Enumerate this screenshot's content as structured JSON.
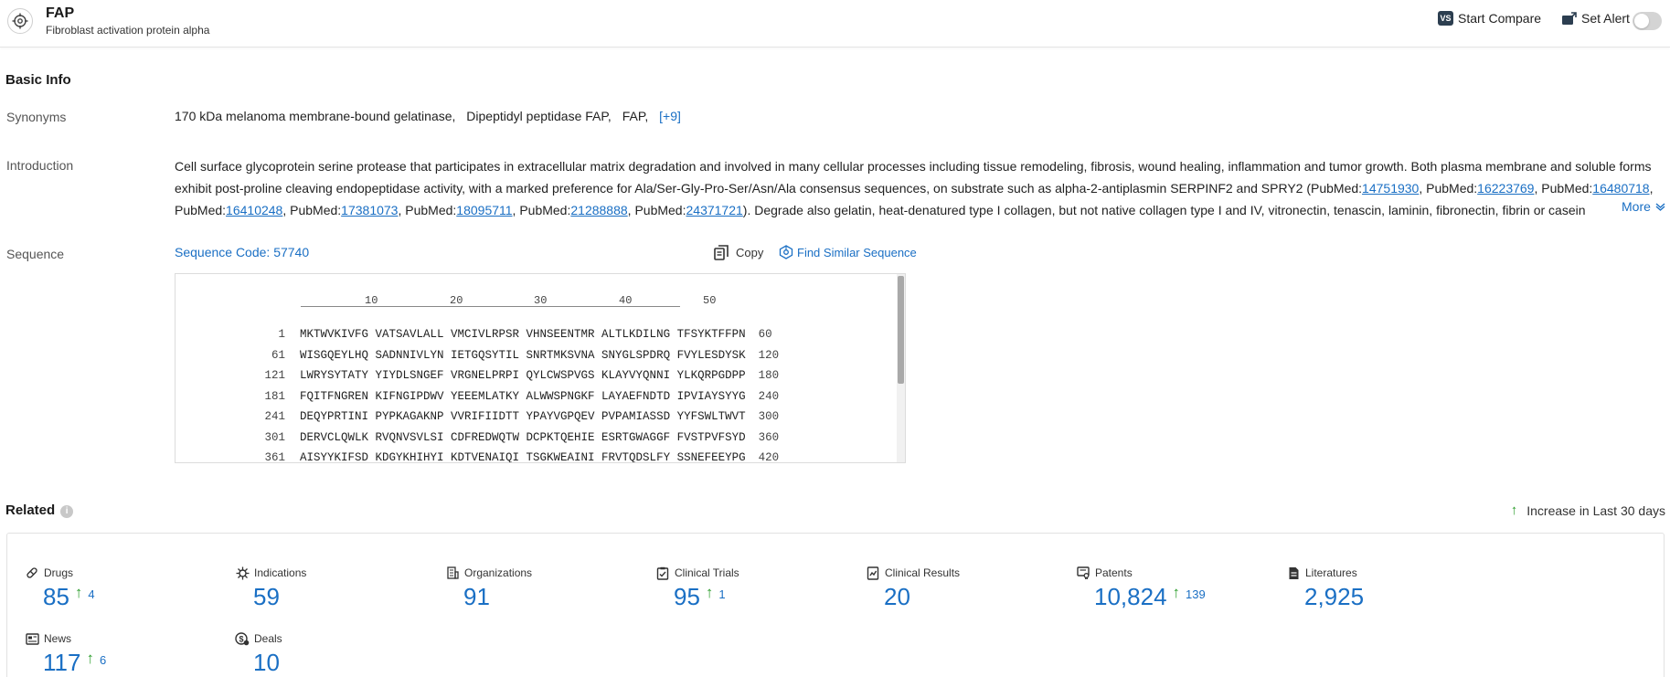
{
  "header": {
    "title": "FAP",
    "subtitle": "Fibroblast activation protein alpha",
    "compare_badge": "VS",
    "compare_label": "Start Compare",
    "alert_label": "Set Alert"
  },
  "basic_info": {
    "title": "Basic Info",
    "synonyms_label": "Synonyms",
    "synonyms": [
      "170 kDa melanoma membrane-bound gelatinase,",
      "Dipeptidyl peptidase FAP,",
      "FAP,"
    ],
    "synonyms_more": "[+9]",
    "introduction_label": "Introduction",
    "intro_text_1": "Cell surface glycoprotein serine protease that participates in extracellular matrix degradation and involved in many cellular processes including tissue remodeling, fibrosis, wound healing, inflammation and tumor growth. Both plasma membrane and soluble forms exhibit post-proline cleaving endopeptidase activity, with a marked preference for Ala/Ser-Gly-Pro-Ser/Asn/Ala consensus sequences, on substrate such as alpha-2-antiplasmin SERPINF2 and SPRY2 (PubMed:",
    "pubmed_prefix": "PubMed:",
    "pubmed_ids": [
      "14751930",
      "16223769",
      "16480718",
      "16410248",
      "17381073",
      "18095711",
      "21288888",
      "24371721"
    ],
    "intro_text_2": "). Degrade also gelatin, heat-denatured type I collagen, but not native collagen type I and IV, vitronectin, tenascin, laminin, fibronectin, fibrin or casein",
    "more_label": "More",
    "sequence_label": "Sequence",
    "sequence_code": "Sequence Code: 57740",
    "copy_label": "Copy",
    "find_similar_label": "Find Similar Sequence",
    "ruler": [
      "10",
      "20",
      "30",
      "40",
      "50"
    ],
    "sequence_lines": [
      {
        "start": "1",
        "residues": "MKTWVKIVFG VATSAVLALL VMCIVLRPSR VHNSEENTMR ALTLKDILNG TFSYKTFFPN",
        "end": "60"
      },
      {
        "start": "61",
        "residues": "WISGQEYLHQ SADNNIVLYN IETGQSYTIL SNRTMKSVNA SNYGLSPDRQ FVYLESDYSK",
        "end": "120"
      },
      {
        "start": "121",
        "residues": "LWRYSYTATY YIYDLSNGEF VRGNELPRPI QYLCWSPVGS KLAYVYQNNI YLKQRPGDPP",
        "end": "180"
      },
      {
        "start": "181",
        "residues": "FQITFNGREN KIFNGIPDWV YEEEMLATKY ALWWSPNGKF LAYAEFNDTD IPVIAYSYYG",
        "end": "240"
      },
      {
        "start": "241",
        "residues": "DEQYPRTINI PYPKAGAKNP VVRIFIIDTT YPAYVGPQEV PVPAMIASSD YYFSWLTWVT",
        "end": "300"
      },
      {
        "start": "301",
        "residues": "DERVCLQWLK RVQNVSVLSI CDFREDWQTW DCPKTQEHIE ESRTGWAGGF FVSTPVFSYD",
        "end": "360"
      },
      {
        "start": "361",
        "residues": "AISYYKIFSD KDGYKHIHYI KDTVENAIQI TSGKWEAINI FRVTQDSLFY SSNEFEEYPG",
        "end": "420"
      }
    ]
  },
  "related": {
    "title": "Related",
    "legend": "Increase in Last 30 days",
    "stats": [
      {
        "label": "Drugs",
        "value": "85",
        "increase": "4",
        "icon": "pill-icon"
      },
      {
        "label": "Indications",
        "value": "59",
        "increase": "",
        "icon": "virus-icon"
      },
      {
        "label": "Organizations",
        "value": "91",
        "increase": "",
        "icon": "building-icon"
      },
      {
        "label": "Clinical Trials",
        "value": "95",
        "increase": "1",
        "icon": "clipboard-icon"
      },
      {
        "label": "Clinical Results",
        "value": "20",
        "increase": "",
        "icon": "chart-doc-icon"
      },
      {
        "label": "Patents",
        "value": "10,824",
        "increase": "139",
        "icon": "patent-icon"
      },
      {
        "label": "Literatures",
        "value": "2,925",
        "increase": "",
        "icon": "document-icon"
      },
      {
        "label": "News",
        "value": "117",
        "increase": "6",
        "icon": "newspaper-icon"
      },
      {
        "label": "Deals",
        "value": "10",
        "increase": "",
        "icon": "handshake-icon"
      }
    ]
  },
  "colors": {
    "link": "#1a6fc4",
    "increase_arrow": "#2e9e2e"
  }
}
